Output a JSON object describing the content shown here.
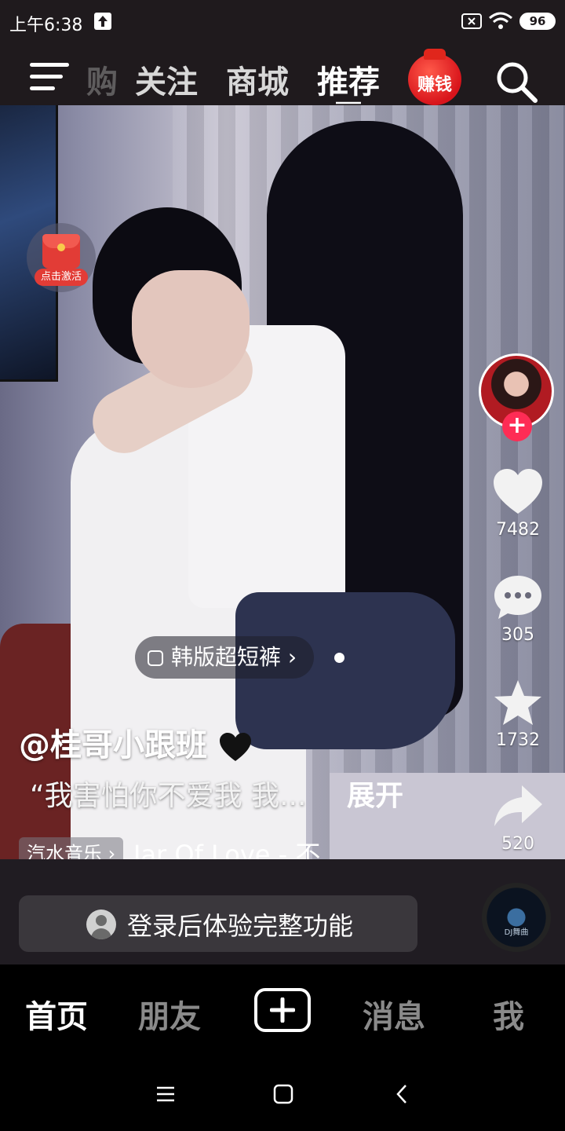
{
  "status_bar": {
    "time": "上午6:38",
    "battery": "96"
  },
  "top_nav": {
    "partial_tab": "购",
    "tabs": [
      {
        "label": "关注",
        "active": false
      },
      {
        "label": "商城",
        "active": false
      },
      {
        "label": "推荐",
        "active": true
      }
    ],
    "earn_badge": "赚钱"
  },
  "video": {
    "activate_badge": "点击激活",
    "product_tag": "韩版超短裤",
    "username": "@桂哥小跟班",
    "caption": "“我害怕你不爱我 我...",
    "expand_label": "展开",
    "music_source": "汽水音乐",
    "music_title": "Jar Of Love - 不..."
  },
  "actions": {
    "likes": "7482",
    "comments": "305",
    "favorites": "1732",
    "shares": "520"
  },
  "login_bar": {
    "text": "登录后体验完整功能"
  },
  "music_disc_label": "DJ舞曲",
  "bottom_tabs": [
    {
      "label": "首页",
      "active": true
    },
    {
      "label": "朋友",
      "active": false
    },
    {
      "label": "消息",
      "active": false
    },
    {
      "label": "我",
      "active": false
    }
  ],
  "colors": {
    "accent": "#fe2c55",
    "nav_bg": "#1f1a1d",
    "panel_bg": "#201c22",
    "login_bar_bg": "#3a373c"
  },
  "icons": [
    "upload-icon",
    "sim-card-icon",
    "wifi-icon",
    "battery-icon",
    "menu-icon",
    "search-icon",
    "heart-icon",
    "comment-icon",
    "star-icon",
    "share-icon",
    "user-icon",
    "plus-icon",
    "recent-apps-icon",
    "home-icon",
    "back-icon"
  ]
}
